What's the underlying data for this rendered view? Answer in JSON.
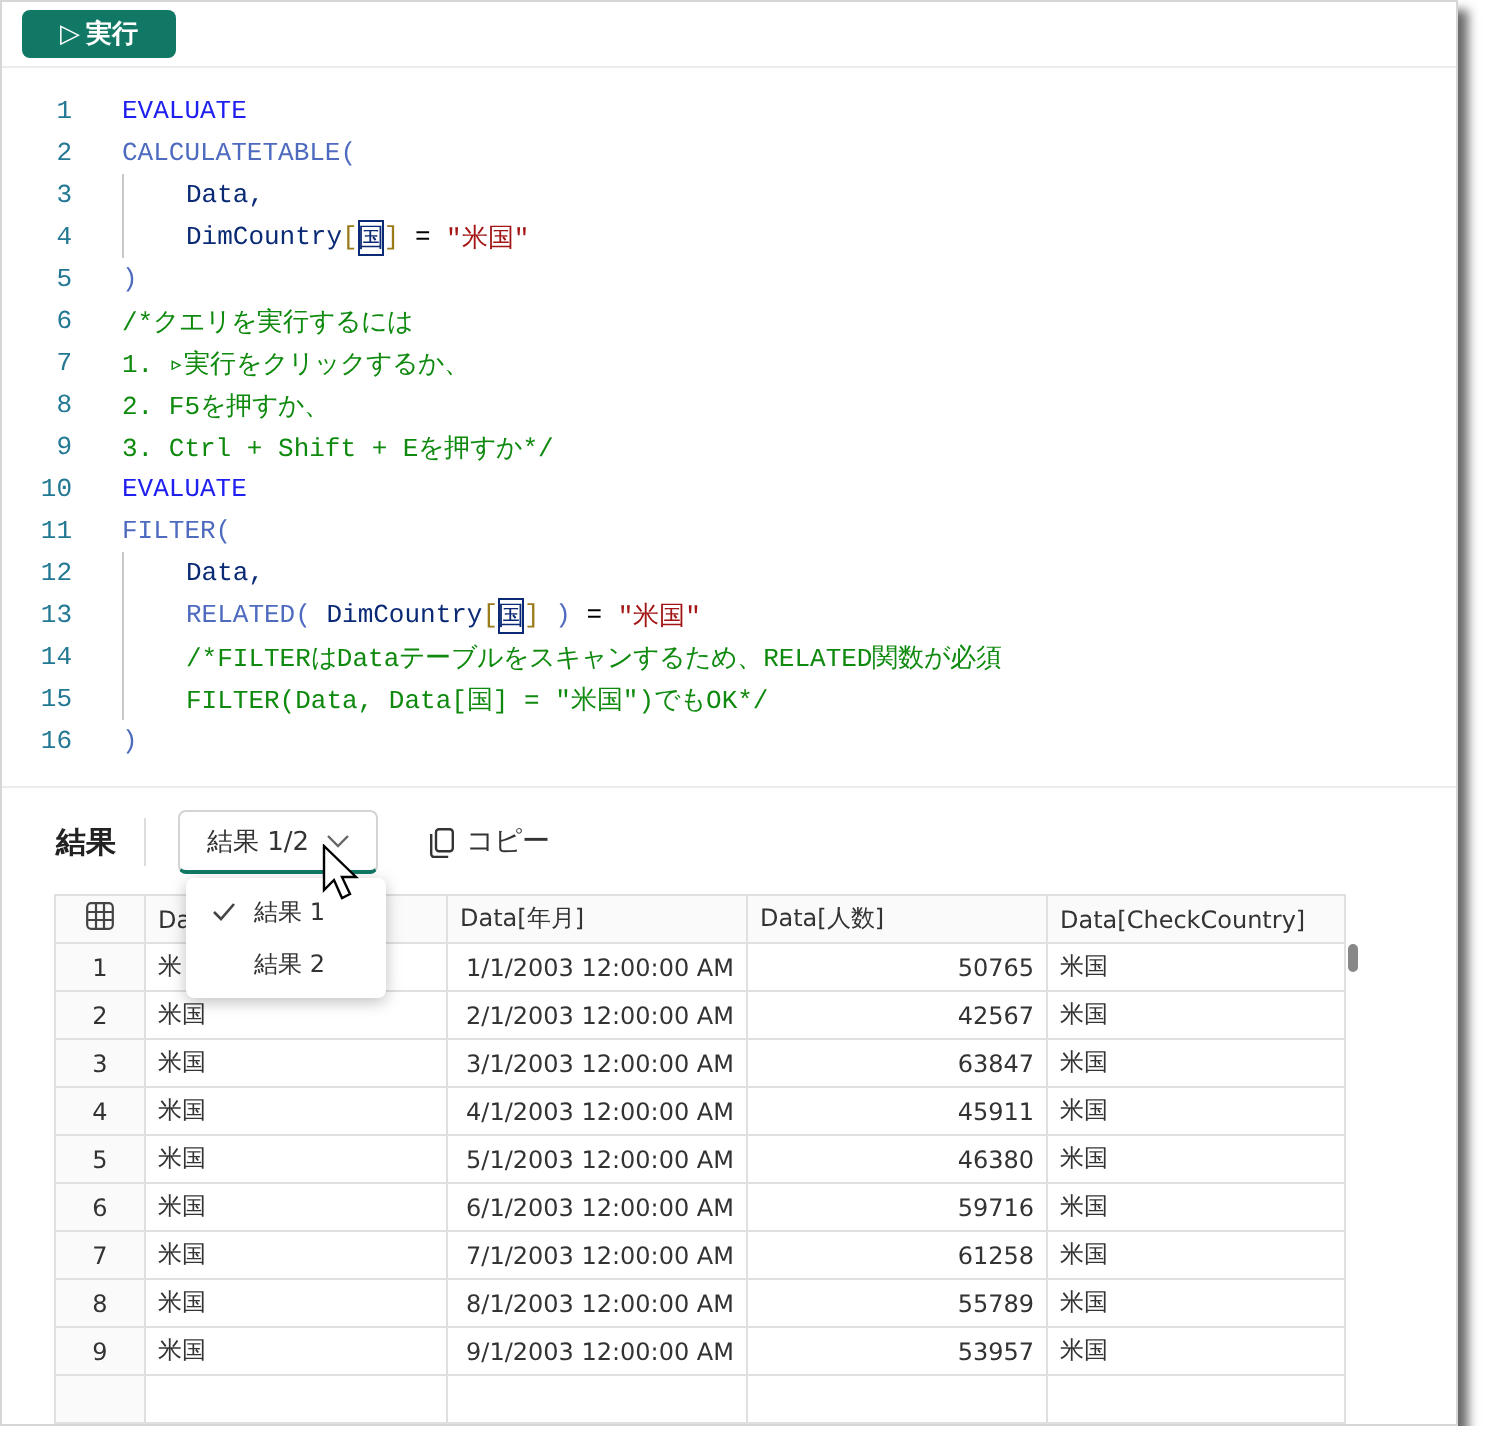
{
  "toolbar": {
    "run_button": {
      "icon": "▷",
      "label": "実行"
    }
  },
  "code_lines": [
    {
      "number": "1",
      "indent": false,
      "tokens": [
        {
          "kind": "kw",
          "text": "EVALUATE"
        }
      ]
    },
    {
      "number": "2",
      "indent": false,
      "tokens": [
        {
          "kind": "fn",
          "text": "CALCULATETABLE("
        }
      ]
    },
    {
      "number": "3",
      "indent": true,
      "tokens": [
        {
          "kind": "id",
          "text": "Data,"
        }
      ]
    },
    {
      "number": "4",
      "indent": true,
      "tokens": [
        {
          "kind": "id",
          "text": "DimCountry"
        },
        {
          "kind": "br",
          "text": "["
        },
        {
          "kind": "boxed",
          "text": "国"
        },
        {
          "kind": "br",
          "text": "]"
        },
        {
          "kind": "op",
          "text": " = "
        },
        {
          "kind": "str",
          "text": "\"米国\""
        }
      ]
    },
    {
      "number": "5",
      "indent": false,
      "tokens": [
        {
          "kind": "fn",
          "text": ")"
        }
      ]
    },
    {
      "number": "6",
      "indent": false,
      "tokens": [
        {
          "kind": "cmt",
          "text": "/*クエリを実行するには"
        }
      ]
    },
    {
      "number": "7",
      "indent": false,
      "tokens": [
        {
          "kind": "cmt",
          "text": "1. ▹実行をクリックするか、"
        }
      ]
    },
    {
      "number": "8",
      "indent": false,
      "tokens": [
        {
          "kind": "cmt",
          "text": "2. F5を押すか、"
        }
      ]
    },
    {
      "number": "9",
      "indent": false,
      "tokens": [
        {
          "kind": "cmt",
          "text": "3. Ctrl + Shift + Eを押すか*/"
        }
      ]
    },
    {
      "number": "10",
      "indent": false,
      "tokens": [
        {
          "kind": "kw",
          "text": "EVALUATE"
        }
      ]
    },
    {
      "number": "11",
      "indent": false,
      "tokens": [
        {
          "kind": "fn",
          "text": "FILTER("
        }
      ]
    },
    {
      "number": "12",
      "indent": true,
      "tokens": [
        {
          "kind": "id",
          "text": "Data,"
        }
      ]
    },
    {
      "number": "13",
      "indent": true,
      "tokens": [
        {
          "kind": "fn",
          "text": "RELATED( "
        },
        {
          "kind": "id",
          "text": "DimCountry"
        },
        {
          "kind": "br",
          "text": "["
        },
        {
          "kind": "boxed",
          "text": "国"
        },
        {
          "kind": "br",
          "text": "]"
        },
        {
          "kind": "fn",
          "text": " )"
        },
        {
          "kind": "op",
          "text": " = "
        },
        {
          "kind": "str",
          "text": "\"米国\""
        }
      ]
    },
    {
      "number": "14",
      "indent": true,
      "tokens": [
        {
          "kind": "cmt",
          "text": "/*FILTERはDataテーブルをスキャンするため、RELATED関数が必須"
        }
      ]
    },
    {
      "number": "15",
      "indent": true,
      "tokens": [
        {
          "kind": "cmt",
          "text": "FILTER(Data, Data[国] = \"米国\")でもOK*/"
        }
      ]
    },
    {
      "number": "16",
      "indent": false,
      "tokens": [
        {
          "kind": "fn",
          "text": ")"
        }
      ]
    }
  ],
  "results": {
    "title": "結果",
    "dropdown": {
      "value": "結果 1/2",
      "expanded": true,
      "options": [
        {
          "label": "結果 1",
          "selected": true
        },
        {
          "label": "結果 2",
          "selected": false
        }
      ]
    },
    "copy_button": "コピー"
  },
  "table": {
    "columns": [
      "",
      "Da",
      "Data[年月]",
      "Data[人数]",
      "Data[CheckCountry]"
    ],
    "rows": [
      [
        "1",
        "米",
        "1/1/2003 12:00:00 AM",
        "50765",
        "米国"
      ],
      [
        "2",
        "米国",
        "2/1/2003 12:00:00 AM",
        "42567",
        "米国"
      ],
      [
        "3",
        "米国",
        "3/1/2003 12:00:00 AM",
        "63847",
        "米国"
      ],
      [
        "4",
        "米国",
        "4/1/2003 12:00:00 AM",
        "45911",
        "米国"
      ],
      [
        "5",
        "米国",
        "5/1/2003 12:00:00 AM",
        "46380",
        "米国"
      ],
      [
        "6",
        "米国",
        "6/1/2003 12:00:00 AM",
        "59716",
        "米国"
      ],
      [
        "7",
        "米国",
        "7/1/2003 12:00:00 AM",
        "61258",
        "米国"
      ],
      [
        "8",
        "米国",
        "8/1/2003 12:00:00 AM",
        "55789",
        "米国"
      ],
      [
        "9",
        "米国",
        "9/1/2003 12:00:00 AM",
        "53957",
        "米国"
      ]
    ]
  }
}
